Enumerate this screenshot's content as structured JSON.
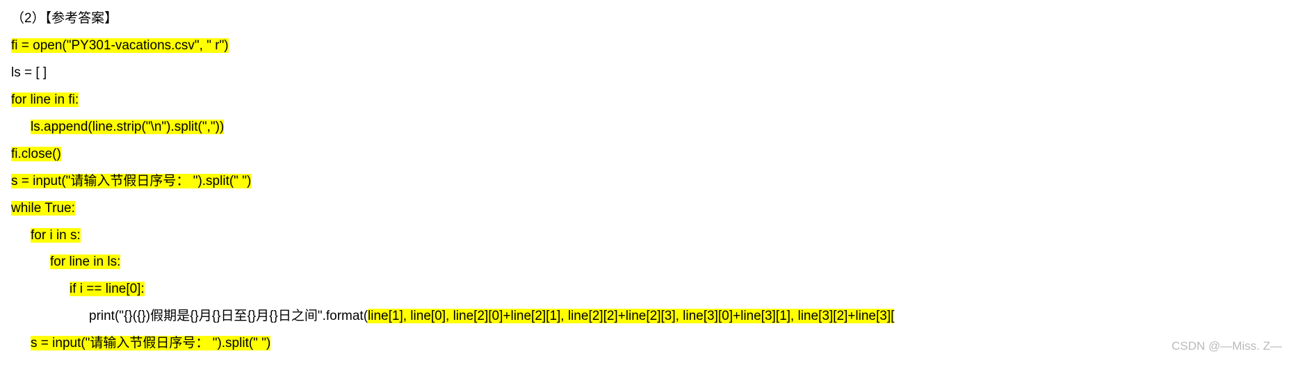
{
  "header": "（2）【参考答案】",
  "code": {
    "l1": "fi = open(\"PY301-vacations.csv\", \" r\")",
    "l2": "ls = [ ]",
    "l3": "for line in fi:",
    "l4": "ls.append(line.strip(\"\\n\").split(\",\"))",
    "l5": "fi.close()",
    "l6": "s = input(\"请输入节假日序号： \").split(\" \")",
    "l7": "while True:",
    "l8": "for i in s:",
    "l9": "for line in ls:",
    "l10": "if i == line[0]:",
    "l11_a": "print(\"{}({})假期是{}月{}日至{}月{}日之间\".format(",
    "l11_b": "line[1], line[0], line[2][0]+line[2][1], line[2][2]+line[2][3], line[3][0]+line[3][1], line[3][2]+line[3][",
    "l12": "s = input(\"请输入节假日序号： \").split(\" \")"
  },
  "watermark": "CSDN @—Miss. Z—"
}
